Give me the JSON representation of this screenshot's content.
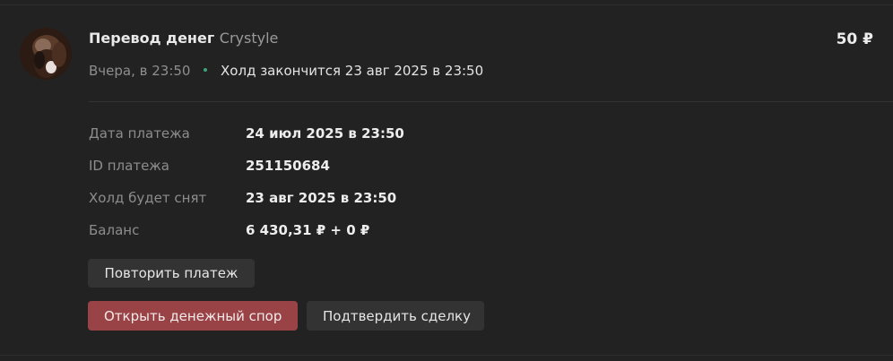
{
  "transaction": {
    "title": "Перевод денег",
    "counterparty": "Crystyle",
    "amount": "50 ₽",
    "time": "Вчера, в 23:50",
    "hold_status": "Холд закончится 23 авг 2025 в 23:50",
    "status_dot_color": "#3fa37a",
    "avatar_icon": "user-avatar"
  },
  "details": [
    {
      "label": "Дата платежа",
      "value": "24 июл 2025 в 23:50"
    },
    {
      "label": "ID платежа",
      "value": "251150684"
    },
    {
      "label": "Холд будет снят",
      "value": "23 авг 2025 в 23:50"
    },
    {
      "label": "Баланс",
      "value": "6 430,31 ₽ + 0 ₽"
    }
  ],
  "actions": {
    "repeat_label": "Повторить платеж",
    "dispute_label": "Открыть денежный спор",
    "confirm_label": "Подтвердить сделку",
    "dispute_color": "#9a4346"
  }
}
